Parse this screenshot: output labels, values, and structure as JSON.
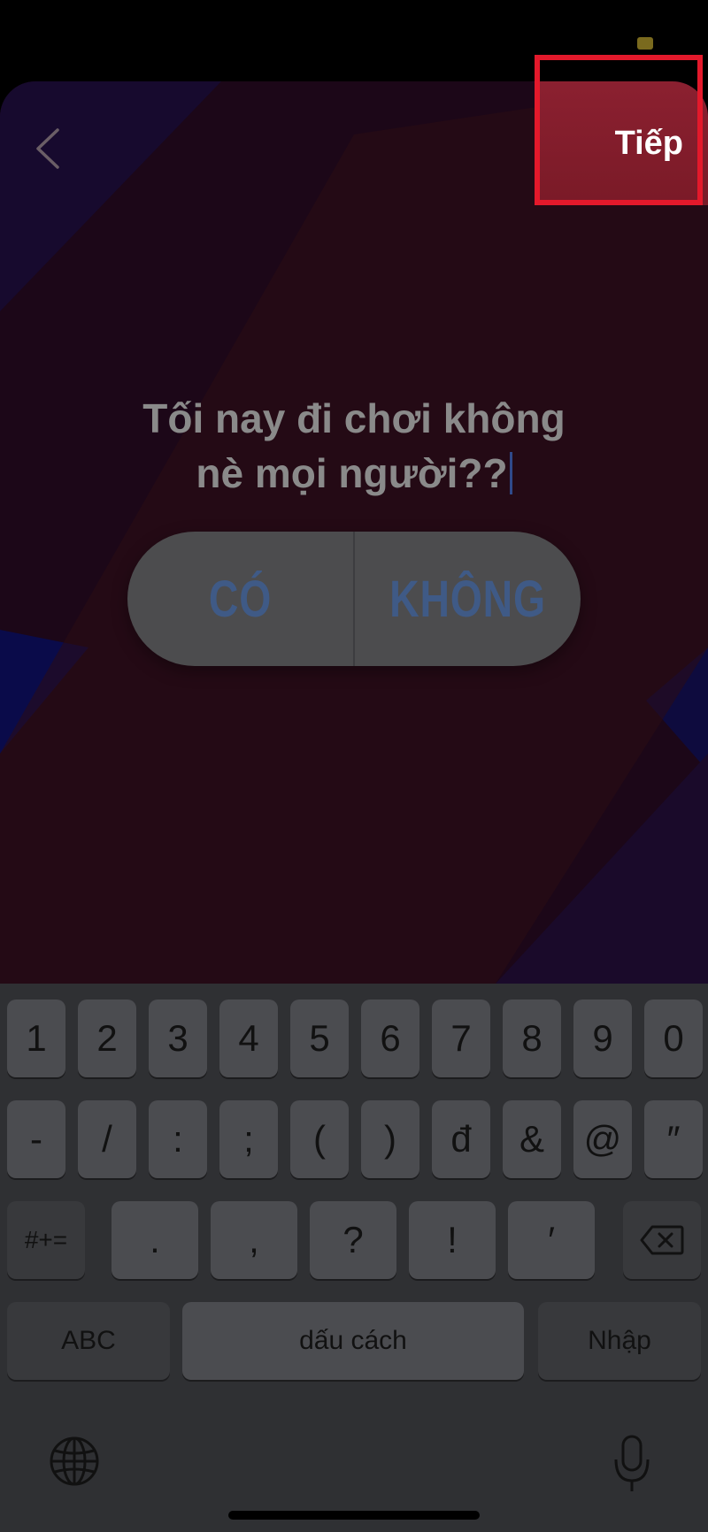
{
  "header": {
    "next_label": "Tiếp",
    "back_icon": "chevron-left-icon"
  },
  "story": {
    "question_line1": "Tối nay đi chơi không",
    "question_line2": "nè mọi người??",
    "poll_option_yes": "CÓ",
    "poll_option_no": "KHÔNG"
  },
  "keyboard": {
    "row1": [
      "1",
      "2",
      "3",
      "4",
      "5",
      "6",
      "7",
      "8",
      "9",
      "0"
    ],
    "row2": [
      "-",
      "/",
      ":",
      ";",
      "(",
      ")",
      "đ",
      "&",
      "@",
      "″"
    ],
    "row3": [
      ".",
      ",",
      "?",
      "!",
      "′"
    ],
    "symbols_label": "#+=",
    "abc_label": "ABC",
    "space_label": "dấu cách",
    "enter_label": "Nhập",
    "globe_icon": "globe-icon",
    "mic_icon": "microphone-icon",
    "delete_icon": "backspace-icon"
  },
  "colors": {
    "highlight": "#e3192b",
    "next_bg": "#8b2030",
    "poll_text": "#3f5a86"
  }
}
